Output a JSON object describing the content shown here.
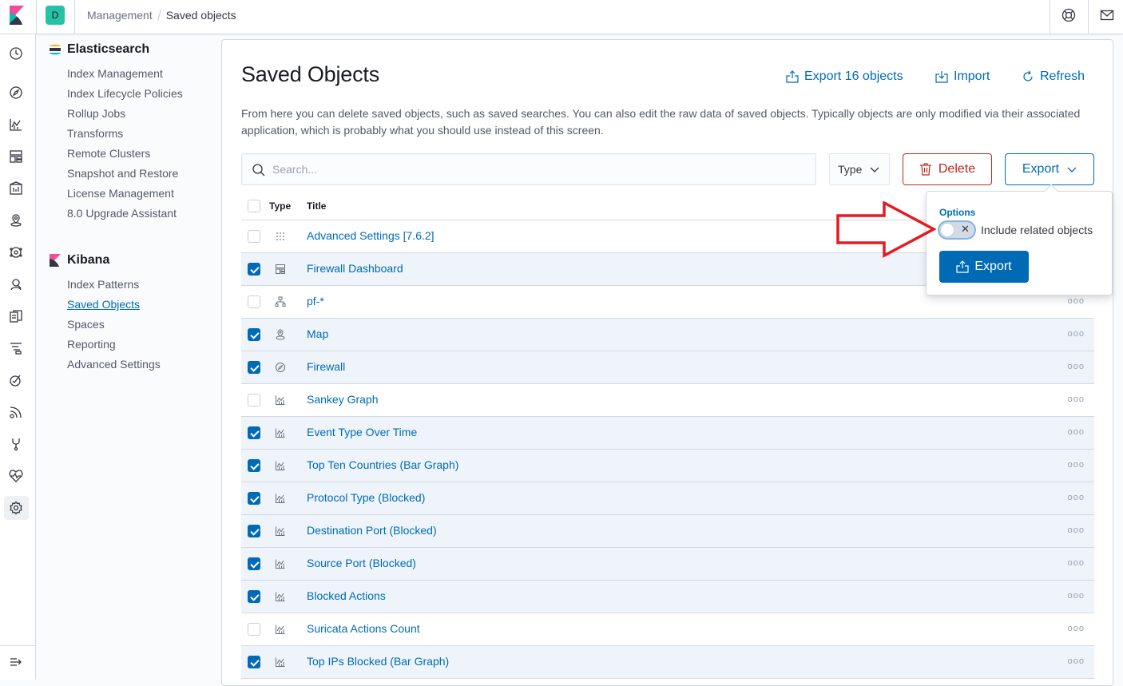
{
  "topbar": {
    "space_initial": "D",
    "breadcrumbs": [
      "Management",
      "Saved objects"
    ]
  },
  "sidebar": {
    "sections": [
      {
        "title": "Elasticsearch",
        "items": [
          "Index Management",
          "Index Lifecycle Policies",
          "Rollup Jobs",
          "Transforms",
          "Remote Clusters",
          "Snapshot and Restore",
          "License Management",
          "8.0 Upgrade Assistant"
        ]
      },
      {
        "title": "Kibana",
        "items": [
          "Index Patterns",
          "Saved Objects",
          "Spaces",
          "Reporting",
          "Advanced Settings"
        ],
        "active": "Saved Objects"
      }
    ]
  },
  "main": {
    "title": "Saved Objects",
    "export_all_label": "Export 16 objects",
    "import_label": "Import",
    "refresh_label": "Refresh",
    "description": "From here you can delete saved objects, such as saved searches. You can also edit the raw data of saved objects. Typically objects are only modified via their associated application, which is probably what you should use instead of this screen.",
    "search_placeholder": "Search...",
    "type_filter_label": "Type",
    "delete_label": "Delete",
    "export_label": "Export",
    "columns": [
      "Type",
      "Title"
    ],
    "rows": [
      {
        "title": "Advanced Settings [7.6.2]",
        "type_icon": "settings-grid-icon",
        "selected": false
      },
      {
        "title": "Firewall Dashboard",
        "type_icon": "dashboard-icon",
        "selected": true
      },
      {
        "title": "pf-*",
        "type_icon": "index-pattern-icon",
        "selected": false
      },
      {
        "title": "Map",
        "type_icon": "map-icon",
        "selected": true
      },
      {
        "title": "Firewall",
        "type_icon": "discover-icon",
        "selected": true
      },
      {
        "title": "Sankey Graph",
        "type_icon": "visualize-icon",
        "selected": false
      },
      {
        "title": "Event Type Over Time",
        "type_icon": "visualize-icon",
        "selected": true
      },
      {
        "title": "Top Ten Countries (Bar Graph)",
        "type_icon": "visualize-icon",
        "selected": true
      },
      {
        "title": "Protocol Type (Blocked)",
        "type_icon": "visualize-icon",
        "selected": true
      },
      {
        "title": "Destination Port (Blocked)",
        "type_icon": "visualize-icon",
        "selected": true
      },
      {
        "title": "Source Port (Blocked)",
        "type_icon": "visualize-icon",
        "selected": true
      },
      {
        "title": "Blocked Actions",
        "type_icon": "visualize-icon",
        "selected": true
      },
      {
        "title": "Suricata Actions Count",
        "type_icon": "visualize-icon",
        "selected": false
      },
      {
        "title": "Top IPs Blocked (Bar Graph)",
        "type_icon": "visualize-icon",
        "selected": true
      }
    ]
  },
  "export_popover": {
    "legend": "Options",
    "include_related_label": "Include related objects",
    "include_related_checked": false,
    "export_label": "Export"
  },
  "colors": {
    "link": "#006bb4",
    "danger": "#bd271e",
    "selected_row": "#eef4fa",
    "annotation_arrow": "#e31b23"
  }
}
